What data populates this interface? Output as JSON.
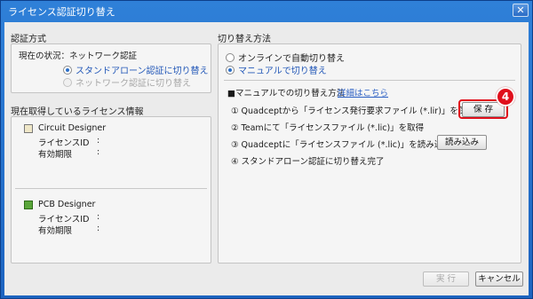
{
  "window": {
    "title": "ライセンス認証切り替え",
    "close_glyph": "✕"
  },
  "auth_method": {
    "section_title": "認証方式",
    "current_status": "現在の状況：ネットワーク認証",
    "options": [
      {
        "label": "スタンドアローン認証に切り替え",
        "selected": true,
        "enabled": true
      },
      {
        "label": "ネットワーク認証に切り替え",
        "selected": false,
        "enabled": false
      }
    ]
  },
  "licenses": {
    "section_title": "現在取得しているライセンス情報",
    "products": [
      {
        "name": "Circuit Designer",
        "id_label": "ライセンスID",
        "id_sep": ":",
        "expiry_label": "有効期限",
        "expiry_sep": ":",
        "icon": "circuit-designer-icon"
      },
      {
        "name": "PCB Designer",
        "id_label": "ライセンスID",
        "id_sep": ":",
        "expiry_label": "有効期限",
        "expiry_sep": ":",
        "icon": "pcb-designer-icon"
      }
    ]
  },
  "switch_method": {
    "section_title": "切り替え方法",
    "options": [
      {
        "label": "オンラインで自動切り替え",
        "selected": false
      },
      {
        "label": "マニュアルで切り替え",
        "selected": true
      }
    ],
    "manual_heading": "■マニュアルでの切り替え方法",
    "details_link": "詳細はこちら",
    "steps": [
      "① Quadceptから「ライセンス発行要求ファイル (*.lir)」を保存",
      "② Teamにて「ライセンスファイル (*.lic)」を取得",
      "③ Quadceptに「ライセンスファイル (*.lic)」を読み込み",
      "④ スタンドアローン認証に切り替え完了"
    ],
    "save_button": "保 存",
    "load_button": "読み込み",
    "step_badge": "4"
  },
  "footer": {
    "execute_button": "実 行",
    "cancel_button": "キャンセル"
  },
  "colors": {
    "titlebar": "#2f80d8",
    "accent_blue": "#2358b8",
    "highlight_red": "#e0101c"
  }
}
